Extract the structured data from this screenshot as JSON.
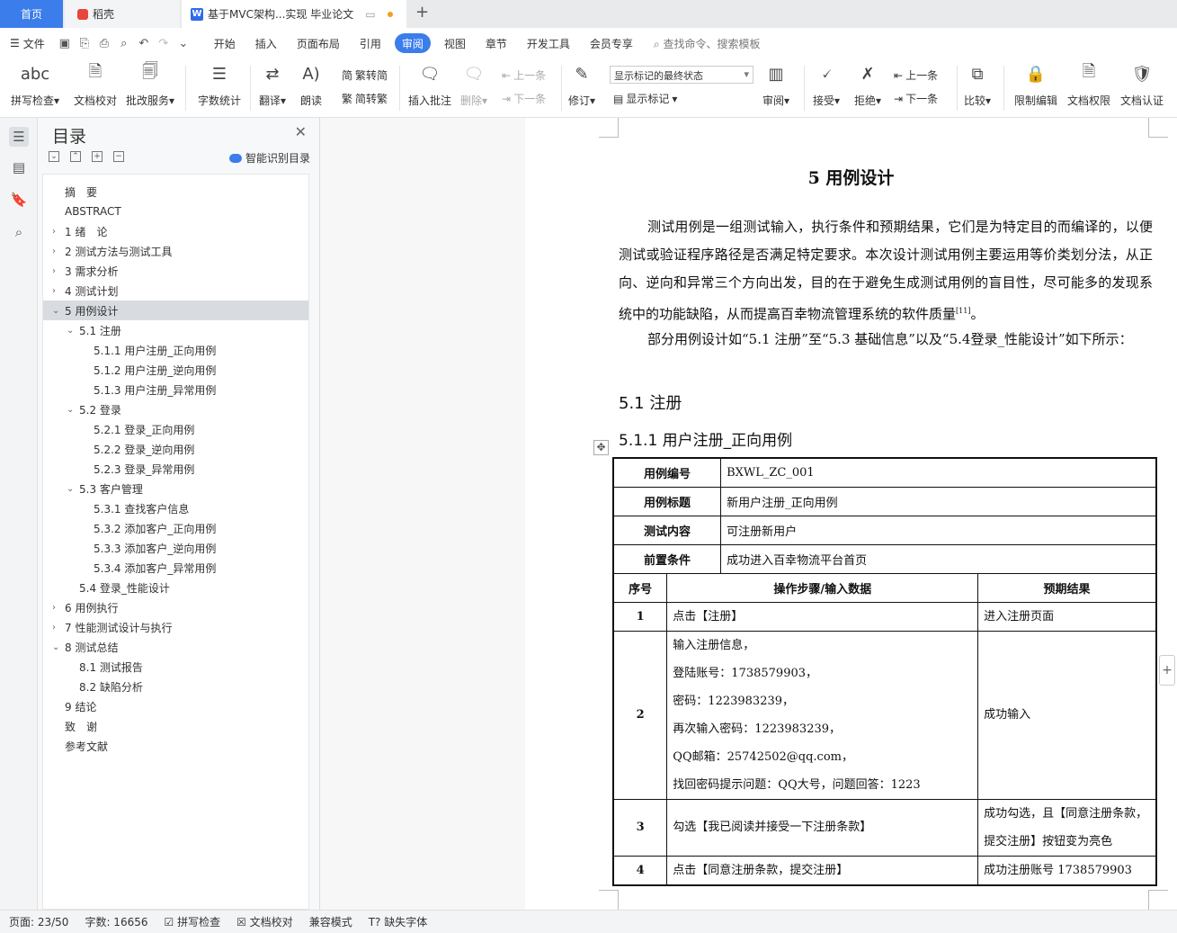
{
  "tabs": {
    "home": "首页",
    "daoke": "稻壳",
    "doc": "基于MVC架构...实现 毕业论文"
  },
  "menu": {
    "file": "文件",
    "items": [
      "开始",
      "插入",
      "页面布局",
      "引用",
      "审阅",
      "视图",
      "章节",
      "开发工具",
      "会员专享"
    ],
    "active": "审阅",
    "search": "查找命令、搜索模板"
  },
  "ribbon": {
    "spell": "拼写检查",
    "doc_check": "文档校对",
    "batch": "批改服务",
    "word_count": "字数统计",
    "translate": "翻译",
    "read": "朗读",
    "trad": "繁转简",
    "simp": "简转繁",
    "insert_comment": "插入批注",
    "delete": "删除",
    "prev": "上一条",
    "next": "下一条",
    "revise": "修订",
    "markup_state": "显示标记的最终状态",
    "show_markup": "显示标记",
    "review": "审阅",
    "accept": "接受",
    "reject": "拒绝",
    "prev2": "上一条",
    "next2": "下一条",
    "compare": "比较",
    "restrict": "限制编辑",
    "perm": "文档权限",
    "cert": "文档认证"
  },
  "toc": {
    "title": "目录",
    "smart": "智能识别目录",
    "items": [
      {
        "text": "摘　要",
        "level": 0,
        "arrow": ""
      },
      {
        "text": "ABSTRACT",
        "level": 0,
        "arrow": ""
      },
      {
        "text": "1 绪　论",
        "level": 0,
        "arrow": ">"
      },
      {
        "text": "2 测试方法与测试工具",
        "level": 0,
        "arrow": ">"
      },
      {
        "text": "3 需求分析",
        "level": 0,
        "arrow": ">"
      },
      {
        "text": "4 测试计划",
        "level": 0,
        "arrow": ">"
      },
      {
        "text": "5 用例设计",
        "level": 0,
        "arrow": "v"
      },
      {
        "text": "5.1 注册",
        "level": 1,
        "arrow": "v"
      },
      {
        "text": "5.1.1 用户注册_正向用例",
        "level": 2,
        "arrow": ""
      },
      {
        "text": "5.1.2 用户注册_逆向用例",
        "level": 2,
        "arrow": ""
      },
      {
        "text": "5.1.3 用户注册_异常用例",
        "level": 2,
        "arrow": ""
      },
      {
        "text": "5.2 登录",
        "level": 1,
        "arrow": "v"
      },
      {
        "text": "5.2.1 登录_正向用例",
        "level": 2,
        "arrow": ""
      },
      {
        "text": "5.2.2 登录_逆向用例",
        "level": 2,
        "arrow": ""
      },
      {
        "text": "5.2.3 登录_异常用例",
        "level": 2,
        "arrow": ""
      },
      {
        "text": "5.3 客户管理",
        "level": 1,
        "arrow": "v"
      },
      {
        "text": "5.3.1 查找客户信息",
        "level": 2,
        "arrow": ""
      },
      {
        "text": "5.3.2 添加客户_正向用例",
        "level": 2,
        "arrow": ""
      },
      {
        "text": "5.3.3 添加客户_逆向用例",
        "level": 2,
        "arrow": ""
      },
      {
        "text": "5.3.4 添加客户_异常用例",
        "level": 2,
        "arrow": ""
      },
      {
        "text": "5.4 登录_性能设计",
        "level": 1,
        "arrow": ""
      },
      {
        "text": "6 用例执行",
        "level": 0,
        "arrow": ">"
      },
      {
        "text": "7 性能测试设计与执行",
        "level": 0,
        "arrow": ">"
      },
      {
        "text": "8 测试总结",
        "level": 0,
        "arrow": "v"
      },
      {
        "text": "8.1 测试报告",
        "level": 1,
        "arrow": ""
      },
      {
        "text": "8.2 缺陷分析",
        "level": 1,
        "arrow": ""
      },
      {
        "text": "9 结论",
        "level": 0,
        "arrow": ""
      },
      {
        "text": "致　谢",
        "level": 0,
        "arrow": ""
      },
      {
        "text": "参考文献",
        "level": 0,
        "arrow": ""
      }
    ],
    "selected_index": 6
  },
  "doc": {
    "heading": "5  用例设计",
    "para1": "测试用例是一组测试输入，执行条件和预期结果，它们是为特定目的而编译的，以便测试或验证程序路径是否满足特定要求。本次设计测试用例主要运用等价类划分法，从正向、逆向和异常三个方向出发，目的在于避免生成测试用例的盲目性，尽可能多的发现系统中的功能缺陷，从而提高百幸物流管理系统的软件质量",
    "cite": "[11]",
    "para1_end": "。",
    "para2": "部分用例设计如“5.1 注册”至“5.3 基础信息”以及“5.4登录_性能设计”如下所示：",
    "h2": "5.1 注册",
    "h3": "5.1.1 用户注册_正向用例",
    "table": {
      "meta": [
        {
          "label": "用例编号",
          "value": "BXWL_ZC_001"
        },
        {
          "label": "用例标题",
          "value": "新用户注册_正向用例"
        },
        {
          "label": "测试内容",
          "value": "可注册新用户"
        },
        {
          "label": "前置条件",
          "value": "成功进入百幸物流平台首页"
        }
      ],
      "headers": [
        "序号",
        "操作步骤/输入数据",
        "预期结果"
      ],
      "rows": [
        {
          "no": "1",
          "steps": [
            "点击【注册】"
          ],
          "expect": "进入注册页面"
        },
        {
          "no": "2",
          "steps": [
            "输入注册信息，",
            "登陆账号：1738579903，",
            "密码：1223983239，",
            "再次输入密码：1223983239，",
            "QQ邮箱：25742502@qq.com，",
            "找回密码提示问题：QQ大号，问题回答：1223"
          ],
          "expect": "成功输入"
        },
        {
          "no": "3",
          "steps": [
            "勾选【我已阅读并接受一下注册条款】"
          ],
          "expect": "成功勾选，且【同意注册条款，提交注册】按钮变为亮色"
        },
        {
          "no": "4",
          "steps": [
            "点击【同意注册条款，提交注册】"
          ],
          "expect": "成功注册账号 1738579903"
        }
      ]
    }
  },
  "status": {
    "page": "页面: 23/50",
    "words": "字数: 16656",
    "spell": "拼写检查",
    "check": "文档校对",
    "compat": "兼容模式",
    "font": "缺失字体"
  }
}
